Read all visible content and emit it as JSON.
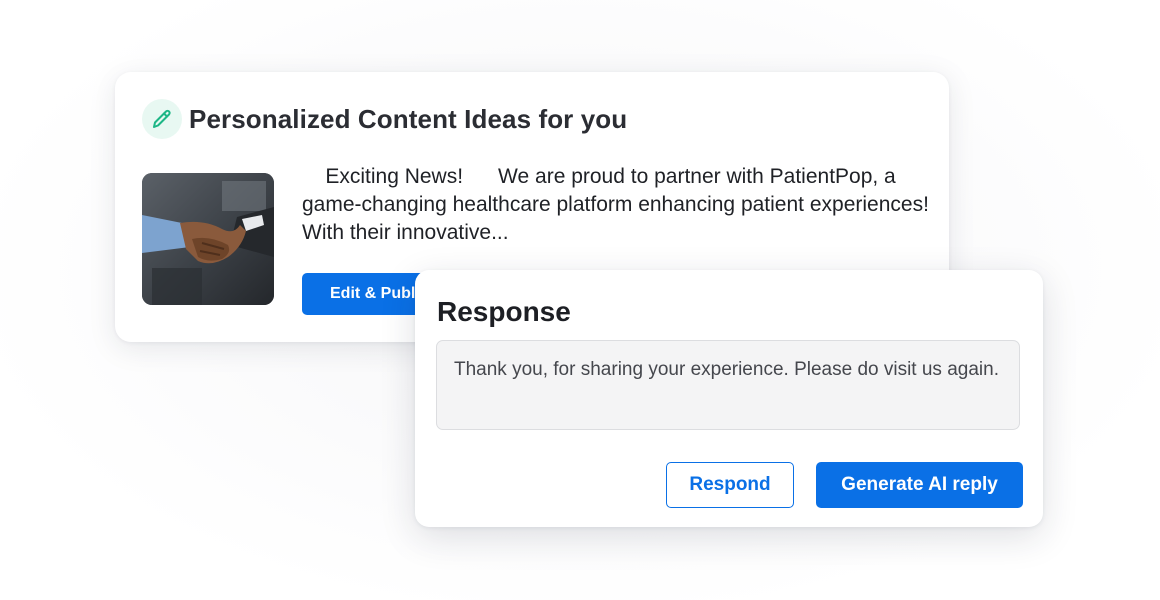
{
  "ideas_card": {
    "title": "Personalized Content Ideas for you",
    "title_icon": "pencil-icon",
    "thumbnail": "handshake-photo",
    "post_text": "    Exciting News!      We are proud to partner with PatientPop, a game-changing healthcare platform enhancing patient experiences!         With their innovative...",
    "edit_publish_label": "Edit & Publish"
  },
  "response_card": {
    "title": "Response",
    "reply_text": "Thank you, for sharing your experience. Please do visit us again.",
    "respond_label": "Respond",
    "generate_label": "Generate AI reply"
  },
  "colors": {
    "primary": "#0a70e6",
    "icon_accent": "#1db686",
    "icon_badge_bg": "#e8f8f2"
  }
}
